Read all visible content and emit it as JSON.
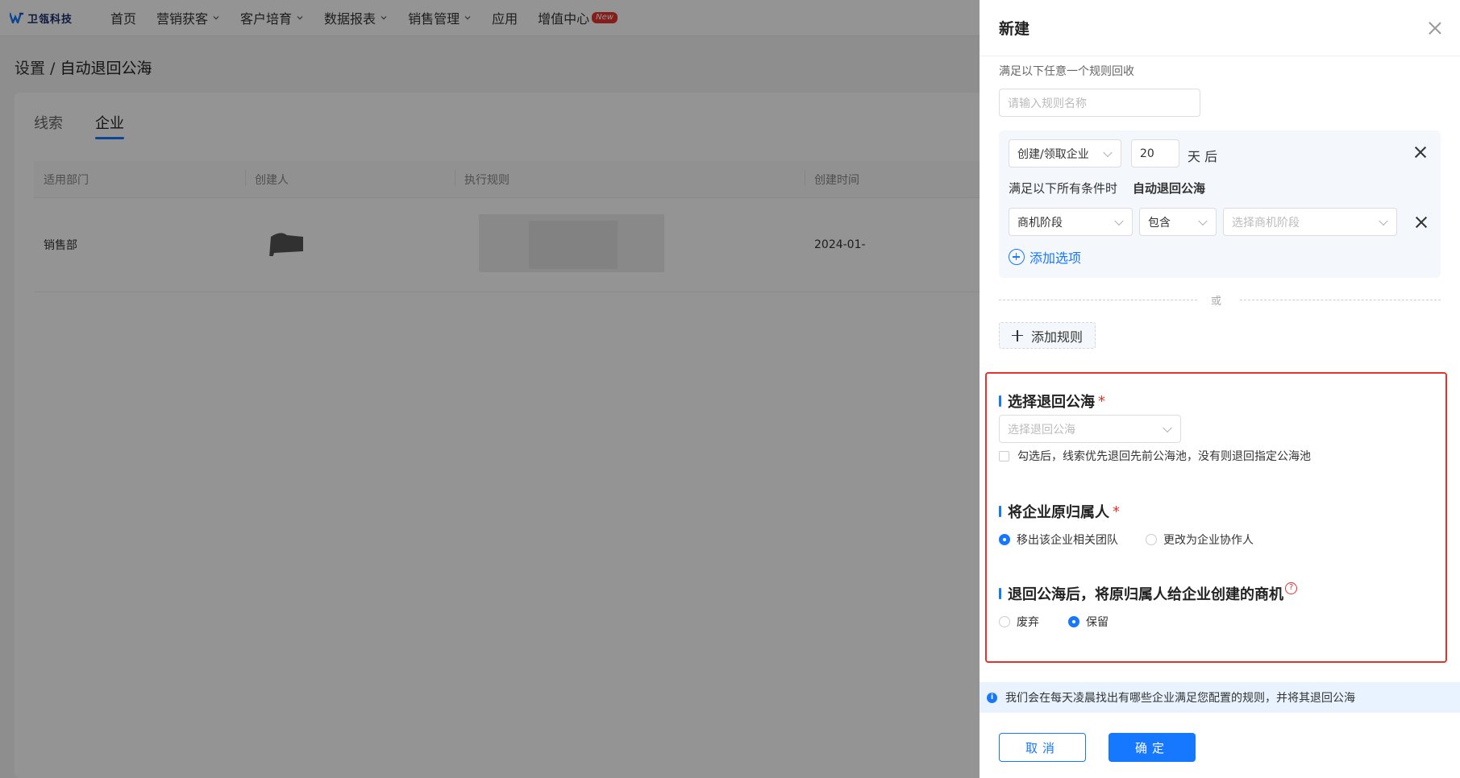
{
  "nav": {
    "logo": "卫瓴科技",
    "items": [
      {
        "label": "首页",
        "dropdown": false
      },
      {
        "label": "营销获客",
        "dropdown": true
      },
      {
        "label": "客户培育",
        "dropdown": true
      },
      {
        "label": "数据报表",
        "dropdown": true
      },
      {
        "label": "销售管理",
        "dropdown": true
      },
      {
        "label": "应用",
        "dropdown": false
      },
      {
        "label": "增值中心",
        "dropdown": false,
        "badge": "New"
      }
    ]
  },
  "breadcrumb": {
    "parent": "设置",
    "separator": " / ",
    "current": "自动退回公海"
  },
  "tabs": [
    {
      "label": "线索",
      "active": false
    },
    {
      "label": "企业",
      "active": true
    }
  ],
  "table": {
    "columns": [
      "适用部门",
      "创建人",
      "执行规则",
      "创建时间"
    ],
    "rows": [
      {
        "department": "销售部",
        "created_at": "2024-01-"
      }
    ]
  },
  "drawer": {
    "title": "新建",
    "hint": "满足以下任意一个规则回收",
    "rule_name_placeholder": "请输入规则名称",
    "rule": {
      "trigger_select": "创建/领取企业",
      "days_value": "20",
      "days_suffix": "天 后",
      "condition_prefix": "满足以下所有条件时",
      "condition_action": "自动退回公海",
      "field_select": "商机阶段",
      "operator_select": "包含",
      "value_placeholder": "选择商机阶段",
      "add_option_label": "添加选项"
    },
    "or_label": "或",
    "add_rule_label": "添加规则",
    "section_pool": {
      "title": "选择退回公海",
      "required": "*",
      "select_placeholder": "选择退回公海",
      "checkbox_label": "勾选后，线索优先退回先前公海池，没有则退回指定公海池"
    },
    "section_owner": {
      "title": "将企业原归属人",
      "required": "*",
      "options": [
        {
          "label": "移出该企业相关团队",
          "selected": true
        },
        {
          "label": "更改为企业协作人",
          "selected": false
        }
      ]
    },
    "section_opportunity": {
      "title": "退回公海后，将原归属人给企业创建的商机",
      "help_icon": "?",
      "options": [
        {
          "label": "废弃",
          "selected": false
        },
        {
          "label": "保留",
          "selected": true
        }
      ]
    },
    "info_icon": "i",
    "info_text": "我们会在每天凌晨找出有哪些企业满足您配置的规则，并将其退回公海",
    "cancel_label": "取消",
    "ok_label": "确定"
  },
  "colors": {
    "primary": "#1677ff",
    "danger": "#e5322d",
    "info_bg": "#e9f3ff"
  }
}
